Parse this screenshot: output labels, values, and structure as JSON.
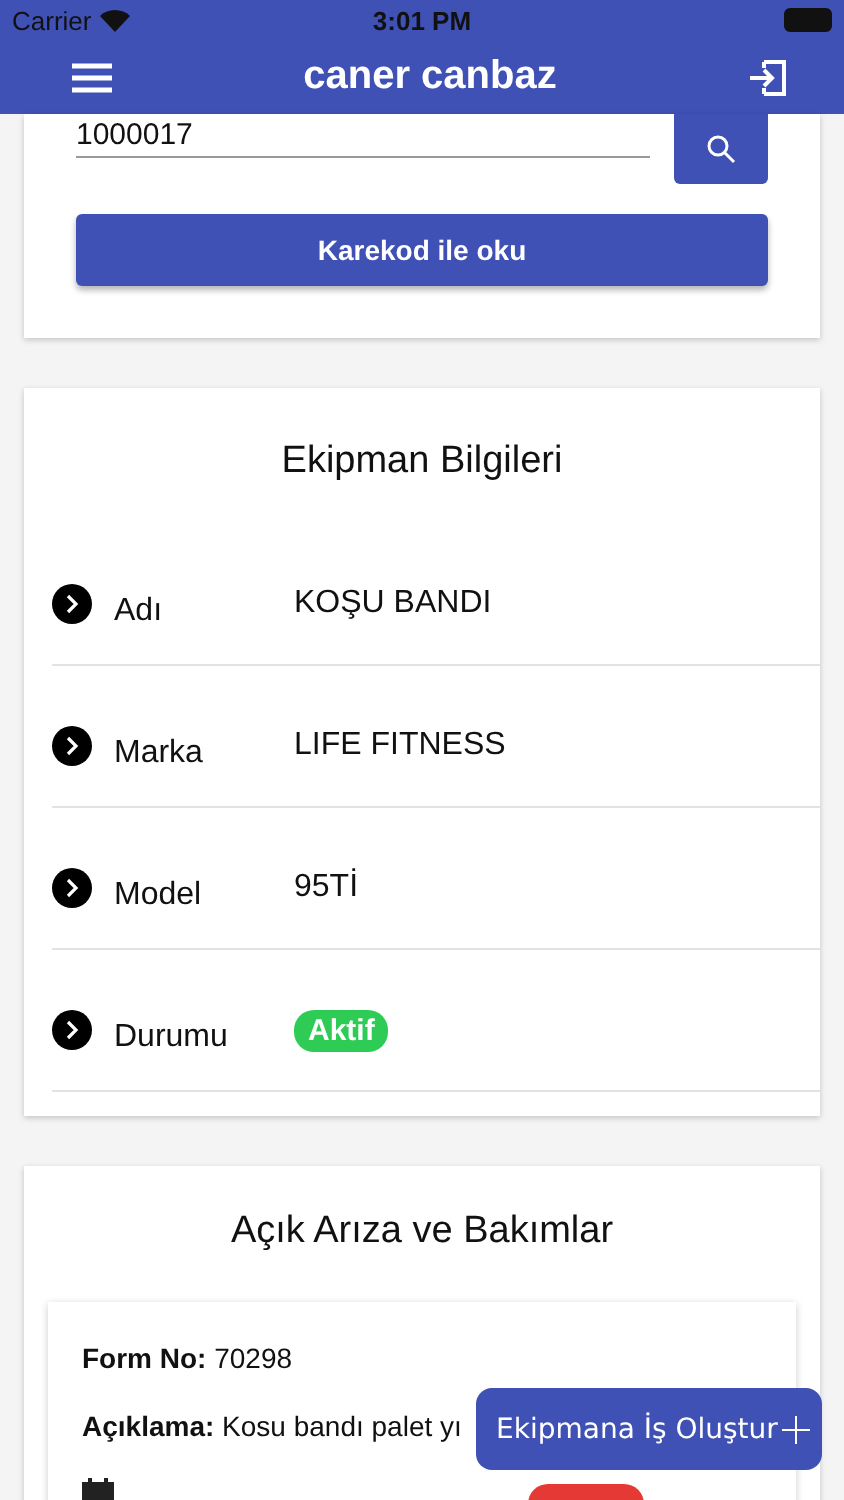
{
  "status_bar": {
    "carrier": "Carrier",
    "time": "3:01 PM"
  },
  "header": {
    "title": "caner canbaz"
  },
  "search": {
    "value": "1000017"
  },
  "qr_button": {
    "label": "Karekod ile oku"
  },
  "equipment": {
    "title": "Ekipman Bilgileri",
    "rows": [
      {
        "label": "Adı",
        "value": "KOŞU BANDI",
        "kind": "text"
      },
      {
        "label": "Marka",
        "value": "LIFE FITNESS",
        "kind": "text"
      },
      {
        "label": "Model",
        "value": "95Tİ",
        "kind": "text"
      },
      {
        "label": "Durumu",
        "value": "Aktif",
        "kind": "badge"
      }
    ]
  },
  "open_faults": {
    "title": "Açık Arıza ve Bakımlar",
    "items": [
      {
        "form_no": "**Form No:** 70298",
        "description": "**Açıklama:** Kosu bandı palet yı"
      }
    ]
  },
  "fab": {
    "label": "Ekipmana İş Oluştur"
  }
}
